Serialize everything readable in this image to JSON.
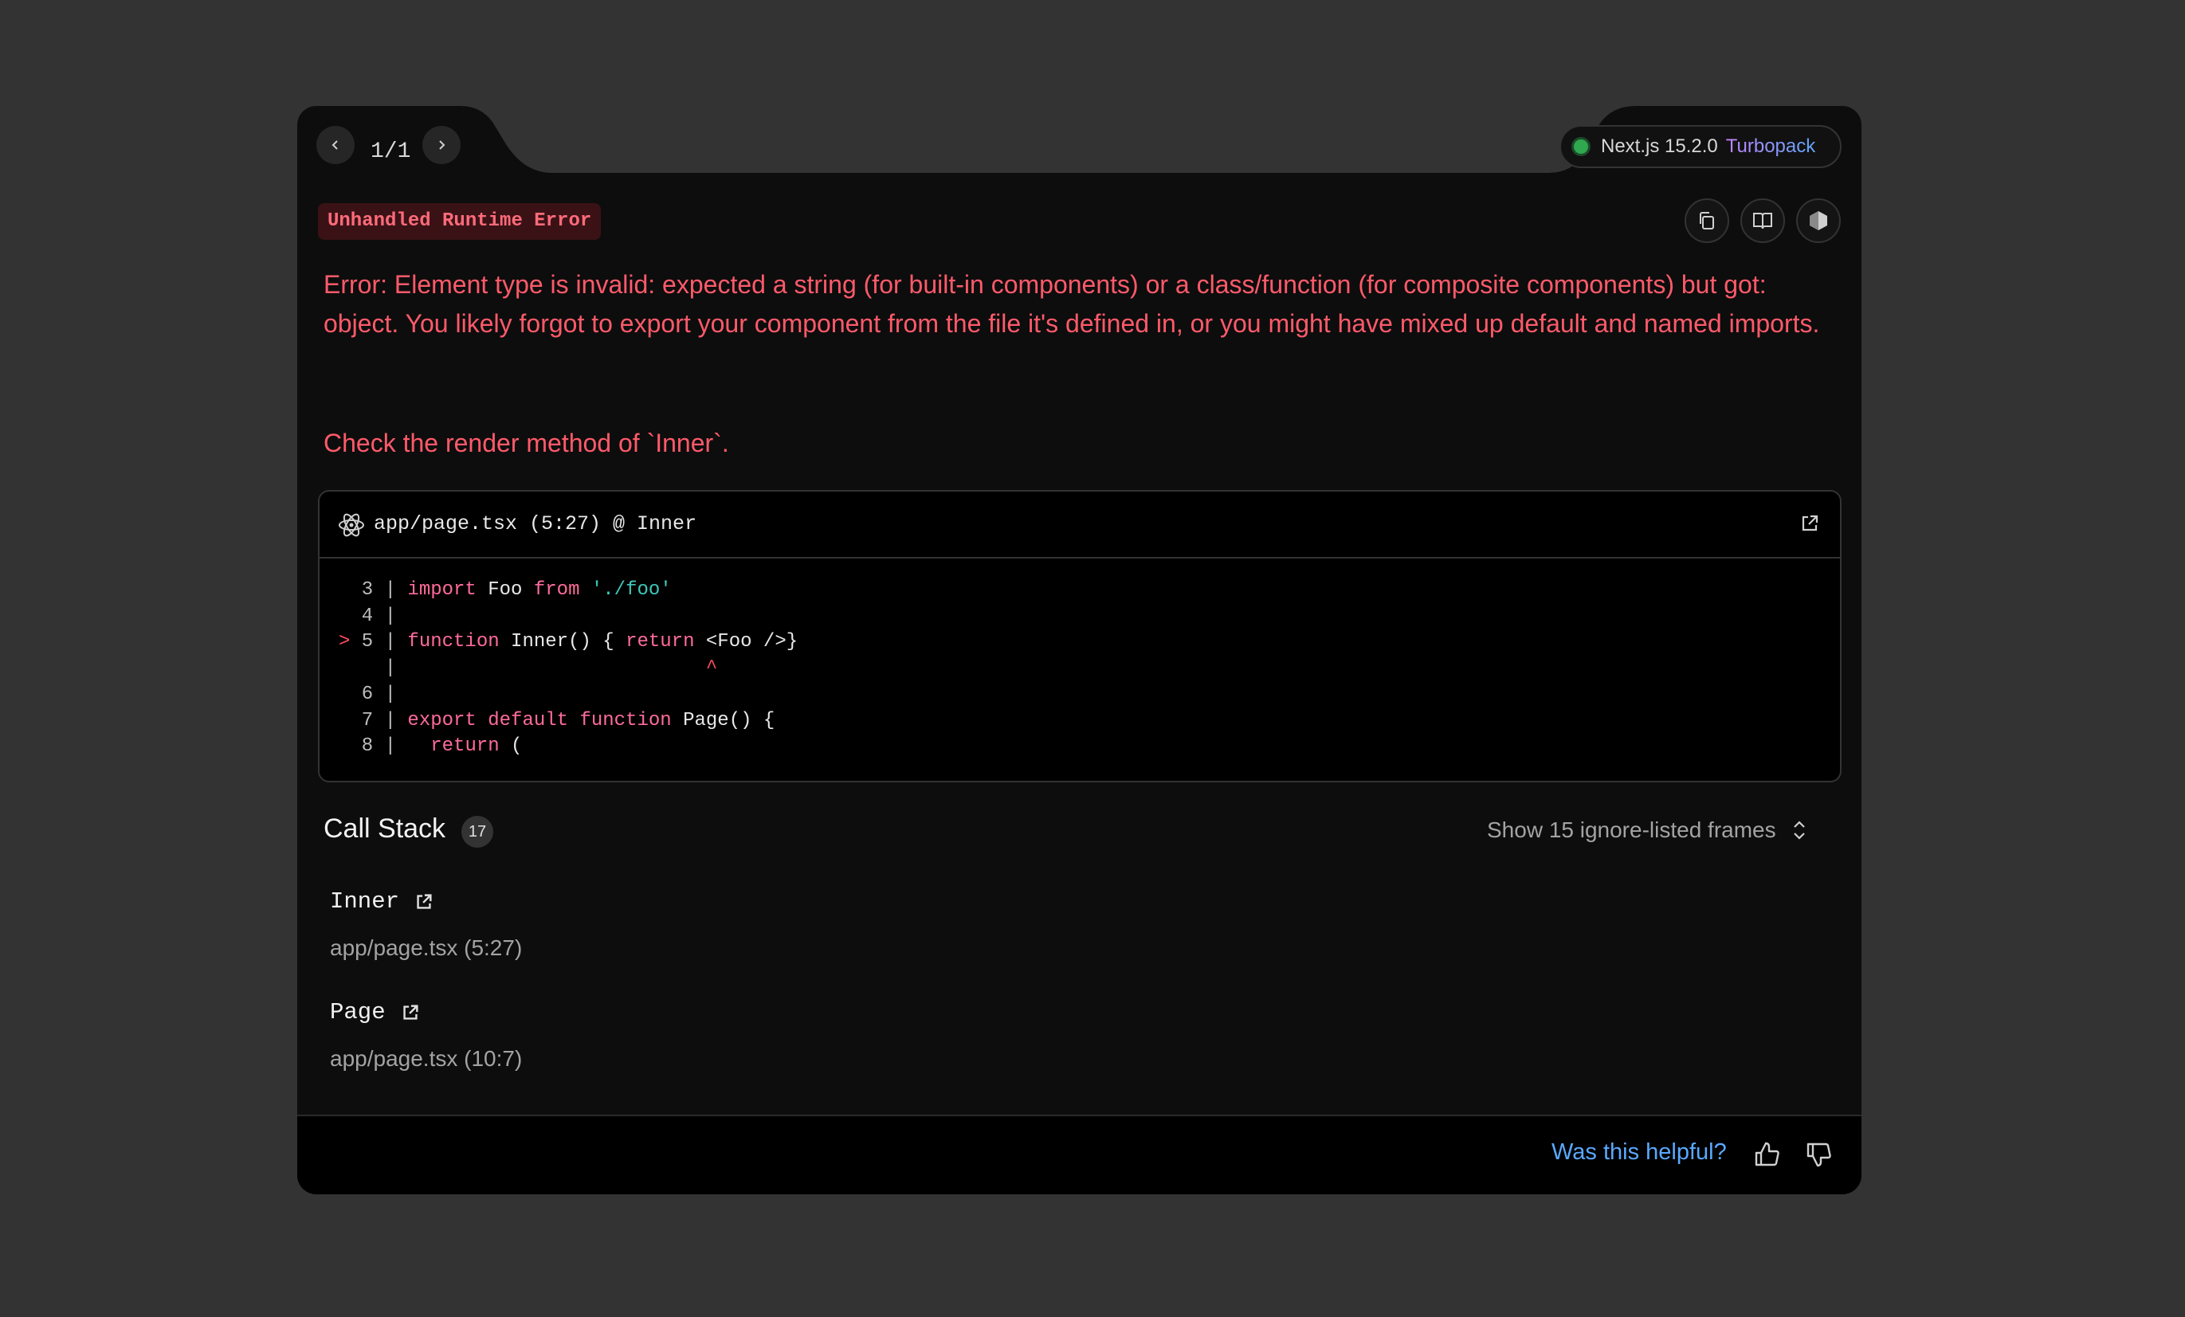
{
  "nav": {
    "counter": "1/1"
  },
  "version": {
    "label": "Next.js 15.2.0",
    "bundler": "Turbopack",
    "status_color": "#2fa84f"
  },
  "badge": "Unhandled Runtime Error",
  "toolbar": {
    "icons": [
      "copy-icon",
      "docs-icon",
      "nextjs-icon"
    ]
  },
  "error": {
    "message": "Error: Element type is invalid: expected a string (for built-in components) or a class/function (for composite components) but got: object. You likely forgot to export your component from the file it's defined in, or you might have mixed up default and named imports.",
    "hint": "Check the render method of `Inner`."
  },
  "code_frame": {
    "file": "app/page.tsx (5:27) @ Inner",
    "lines": [
      {
        "prefix": "  3 | ",
        "code": [
          [
            "kw",
            "import"
          ],
          [
            "t",
            " Foo "
          ],
          [
            "kw",
            "from"
          ],
          [
            "t",
            " "
          ],
          [
            "str",
            "'./foo'"
          ]
        ]
      },
      {
        "prefix": "  4 | ",
        "code": []
      },
      {
        "prefix": "> 5 | ",
        "code": [
          [
            "kw",
            "function"
          ],
          [
            "t",
            " Inner() { "
          ],
          [
            "kw",
            "return"
          ],
          [
            "t",
            " <Foo />}"
          ]
        ]
      },
      {
        "prefix": "    | ",
        "code": [
          [
            "mark",
            "                          ^"
          ]
        ]
      },
      {
        "prefix": "  6 | ",
        "code": []
      },
      {
        "prefix": "  7 | ",
        "code": [
          [
            "kw",
            "export default function"
          ],
          [
            "t",
            " Page() {"
          ]
        ]
      },
      {
        "prefix": "  8 | ",
        "code": [
          [
            "t",
            "  "
          ],
          [
            "kw",
            "return"
          ],
          [
            "t",
            " ("
          ]
        ]
      }
    ]
  },
  "call_stack": {
    "title": "Call Stack",
    "count": "17",
    "show_frames": "Show 15 ignore-listed frames",
    "frames": [
      {
        "name": "Inner",
        "location": "app/page.tsx (5:27)"
      },
      {
        "name": "Page",
        "location": "app/page.tsx (10:7)"
      }
    ]
  },
  "footer": {
    "helpful": "Was this helpful?"
  }
}
